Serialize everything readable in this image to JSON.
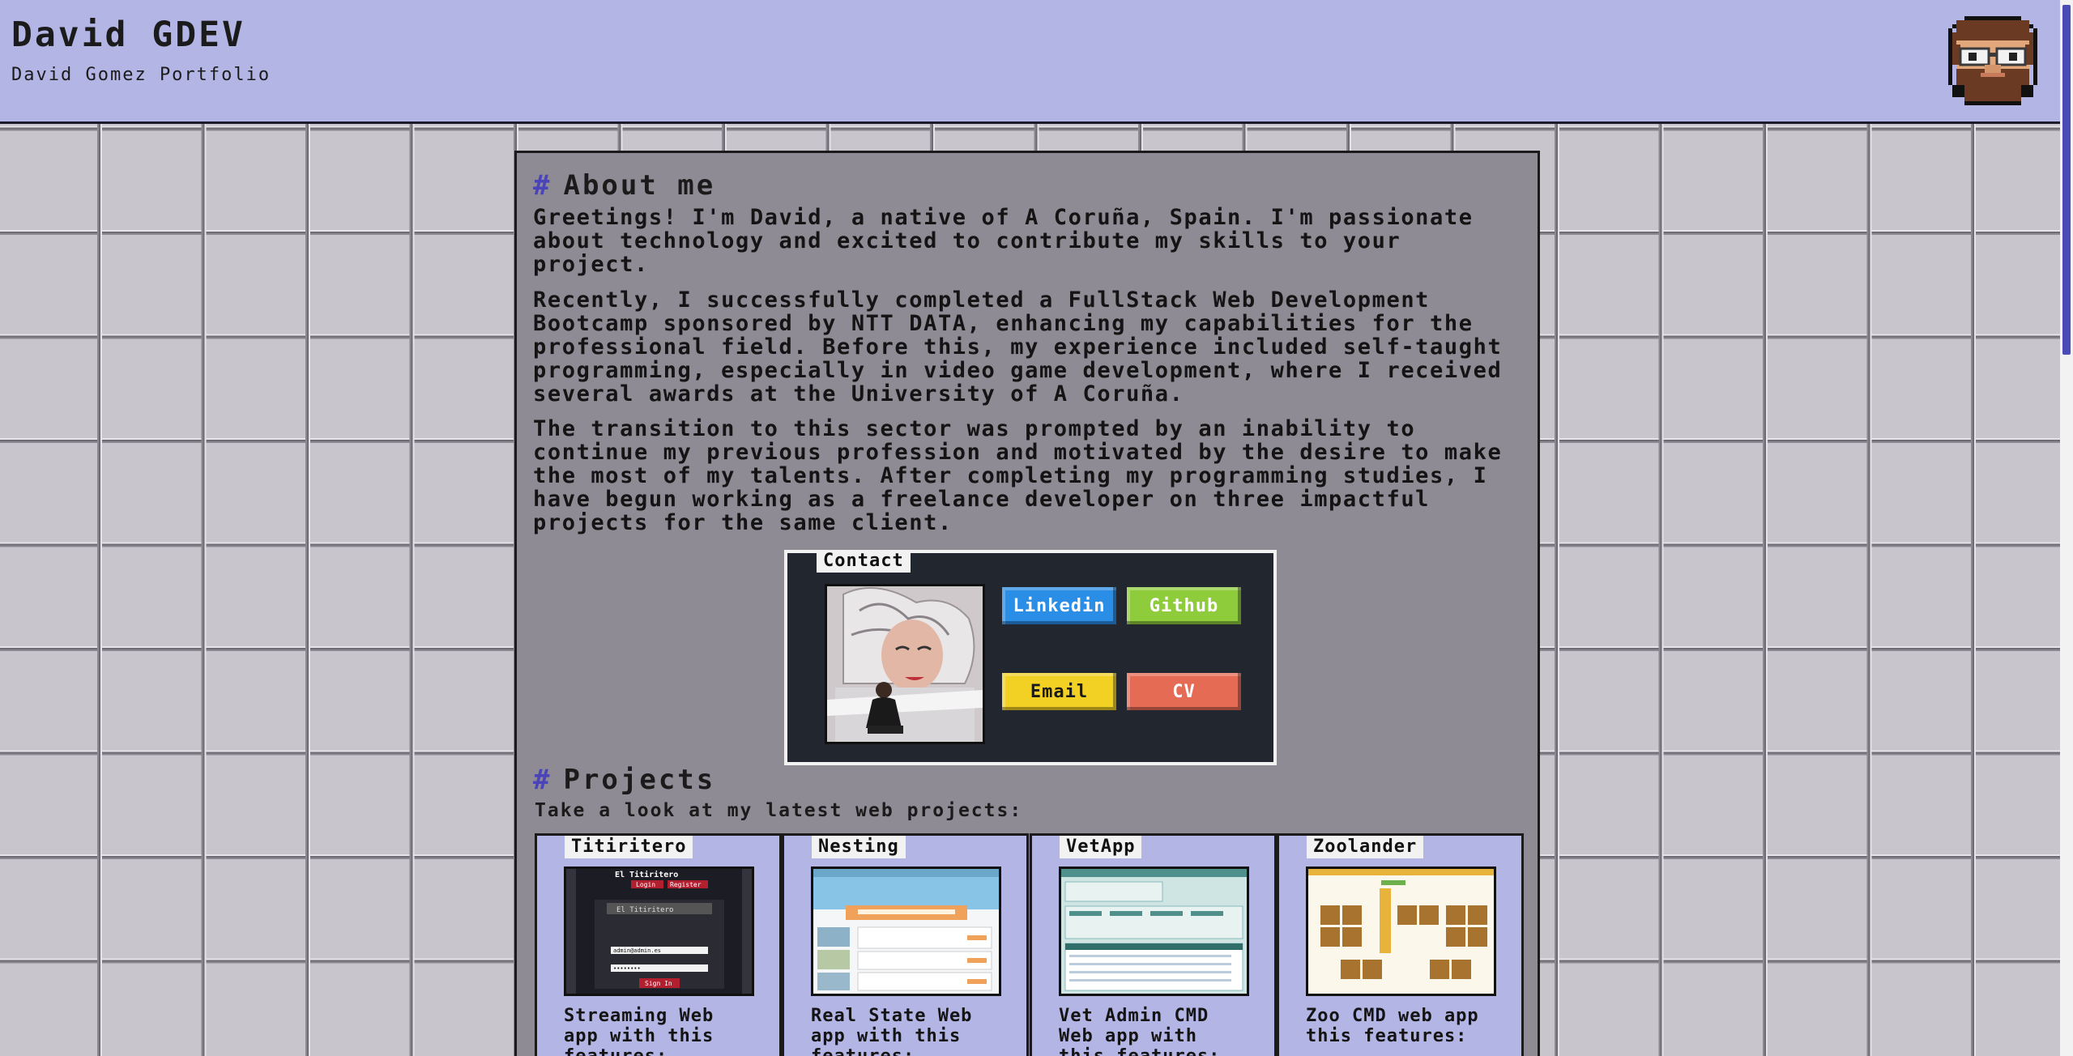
{
  "header": {
    "title": "David GDEV",
    "subtitle": "David Gomez Portfolio"
  },
  "about": {
    "title": "About me",
    "paragraphs": [
      "Greetings! I'm David, a native of A Coruña, Spain. I'm passionate about technology and excited to contribute my skills to your project.",
      "Recently, I successfully completed a FullStack Web Development Bootcamp sponsored by NTT DATA, enhancing my capabilities for the professional field. Before this, my experience included self-taught programming, especially in video game development, where I received several awards at the University of A Coruña.",
      "The transition to this sector was prompted by an inability to continue my previous profession and motivated by the desire to make the most of my talents. After completing my programming studies, I have begun working as a freelance developer on three impactful projects for the same client."
    ]
  },
  "contact": {
    "legend": "Contact",
    "buttons": {
      "linkedin": "Linkedin",
      "github": "Github",
      "email": "Email",
      "cv": "CV"
    }
  },
  "projects": {
    "title": "Projects",
    "subtitle": "Take a look at my latest web projects:",
    "items": [
      {
        "name": "Titiritero",
        "description": "Streaming Web app with this features:",
        "thumb": {
          "app_name": "El Titiritero",
          "login": "Login",
          "register": "Register",
          "email": "admin@admin.es",
          "password": "••••••••",
          "sign_in": "Sign In"
        }
      },
      {
        "name": "Nesting",
        "description": "Real State Web app with this features:"
      },
      {
        "name": "VetApp",
        "description": "Vet Admin CMD Web app with this features:"
      },
      {
        "name": "Zoolander",
        "description": "Zoo CMD web app this features:"
      }
    ]
  },
  "colors": {
    "header_bg": "#b3b5e5",
    "panel_bg": "#8f8b95",
    "accent": "#4a44b8",
    "linkedin": "#2b8ee6",
    "github": "#8fcc3c",
    "email": "#f2d024",
    "cv": "#e66b55"
  }
}
